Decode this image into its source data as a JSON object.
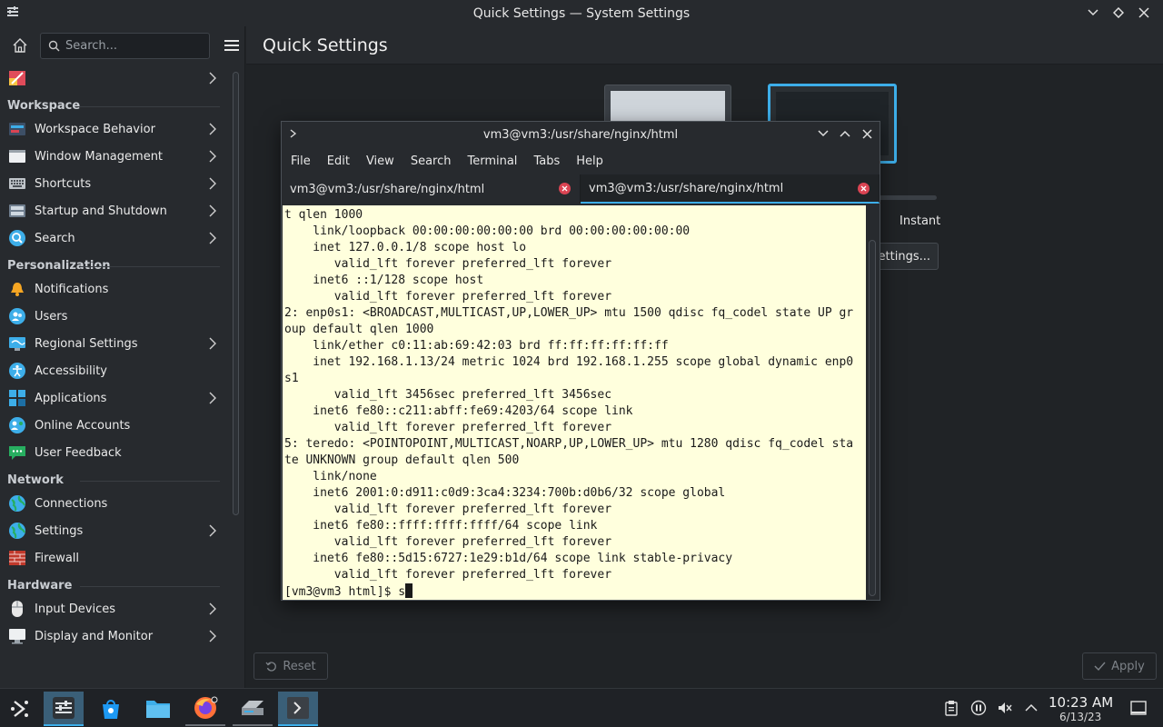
{
  "window": {
    "title": "Quick Settings — System Settings"
  },
  "search": {
    "placeholder": "Search..."
  },
  "sidebar": {
    "items_top": [
      {
        "label": "",
        "icon": "appearance-icon"
      }
    ],
    "categories": [
      {
        "title": "Workspace",
        "items": [
          {
            "label": "Workspace Behavior",
            "icon": "workspace-behavior-icon",
            "chevron": true
          },
          {
            "label": "Window Management",
            "icon": "window-management-icon",
            "chevron": true
          },
          {
            "label": "Shortcuts",
            "icon": "keyboard-icon",
            "chevron": true
          },
          {
            "label": "Startup and Shutdown",
            "icon": "startup-icon",
            "chevron": true
          },
          {
            "label": "Search",
            "icon": "search-icon",
            "chevron": true
          }
        ]
      },
      {
        "title": "Personalization",
        "items": [
          {
            "label": "Notifications",
            "icon": "bell-icon",
            "chevron": false
          },
          {
            "label": "Users",
            "icon": "users-icon",
            "chevron": false
          },
          {
            "label": "Regional Settings",
            "icon": "regional-icon",
            "chevron": true
          },
          {
            "label": "Accessibility",
            "icon": "accessibility-icon",
            "chevron": false
          },
          {
            "label": "Applications",
            "icon": "applications-icon",
            "chevron": true
          },
          {
            "label": "Online Accounts",
            "icon": "online-accounts-icon",
            "chevron": false
          },
          {
            "label": "User Feedback",
            "icon": "feedback-icon",
            "chevron": false
          }
        ]
      },
      {
        "title": "Network",
        "items": [
          {
            "label": "Connections",
            "icon": "globe-icon",
            "chevron": false
          },
          {
            "label": "Settings",
            "icon": "globe-icon",
            "chevron": true
          },
          {
            "label": "Firewall",
            "icon": "firewall-icon",
            "chevron": false
          }
        ]
      },
      {
        "title": "Hardware",
        "items": [
          {
            "label": "Input Devices",
            "icon": "mouse-icon",
            "chevron": true
          },
          {
            "label": "Display and Monitor",
            "icon": "monitor-icon",
            "chevron": true
          }
        ]
      }
    ]
  },
  "main": {
    "title": "Quick Settings",
    "instant_label": "Instant",
    "settings_button": "Settings...",
    "reset_button": "Reset",
    "apply_button": "Apply"
  },
  "konsole": {
    "title": "vm3@vm3:/usr/share/nginx/html",
    "menu": [
      "File",
      "Edit",
      "View",
      "Search",
      "Terminal",
      "Tabs",
      "Help"
    ],
    "tabs": [
      {
        "label": "vm3@vm3:/usr/share/nginx/html",
        "active": false
      },
      {
        "label": "vm3@vm3:/usr/share/nginx/html",
        "active": true
      }
    ],
    "lines": [
      "t qlen 1000",
      "    link/loopback 00:00:00:00:00:00 brd 00:00:00:00:00:00",
      "    inet 127.0.0.1/8 scope host lo",
      "       valid_lft forever preferred_lft forever",
      "    inet6 ::1/128 scope host",
      "       valid_lft forever preferred_lft forever",
      "2: enp0s1: <BROADCAST,MULTICAST,UP,LOWER_UP> mtu 1500 qdisc fq_codel state UP gr",
      "oup default qlen 1000",
      "    link/ether c0:11:ab:69:42:03 brd ff:ff:ff:ff:ff:ff",
      "    inet 192.168.1.13/24 metric 1024 brd 192.168.1.255 scope global dynamic enp0",
      "s1",
      "       valid_lft 3456sec preferred_lft 3456sec",
      "    inet6 fe80::c211:abff:fe69:4203/64 scope link",
      "       valid_lft forever preferred_lft forever",
      "5: teredo: <POINTOPOINT,MULTICAST,NOARP,UP,LOWER_UP> mtu 1280 qdisc fq_codel sta",
      "te UNKNOWN group default qlen 500",
      "    link/none",
      "    inet6 2001:0:d911:c0d9:3ca4:3234:700b:d0b6/32 scope global",
      "       valid_lft forever preferred_lft forever",
      "    inet6 fe80::ffff:ffff:ffff/64 scope link",
      "       valid_lft forever preferred_lft forever",
      "    inet6 fe80::5d15:6727:1e29:b1d/64 scope link stable-privacy",
      "       valid_lft forever preferred_lft forever"
    ],
    "prompt": "[vm3@vm3 html]$ s"
  },
  "taskbar": {
    "apps": [
      "app-launcher-icon",
      "system-settings-icon",
      "discover-icon",
      "file-manager-icon",
      "firefox-icon",
      "scanner-icon",
      "konsole-icon"
    ],
    "clock_time": "10:23 AM",
    "clock_date": "6/13/23"
  },
  "colors": {
    "accent": "#3daee9",
    "terminal_bg": "#ffffdd",
    "close_red": "#da4453"
  }
}
